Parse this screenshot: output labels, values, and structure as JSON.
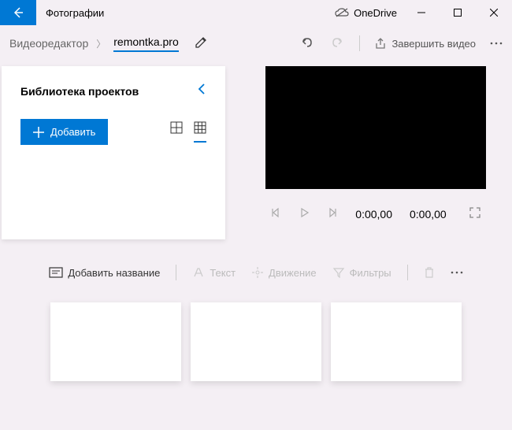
{
  "titlebar": {
    "app_title": "Фотографии",
    "onedrive_label": "OneDrive"
  },
  "breadcrumb": {
    "parent": "Видеоредактор",
    "current": "remontka.pro"
  },
  "topbar": {
    "finish_label": "Завершить видео"
  },
  "library": {
    "title": "Библиотека проектов",
    "add_label": "Добавить"
  },
  "playback": {
    "current_time": "0:00,00",
    "total_time": "0:00,00"
  },
  "toolbar": {
    "add_title": "Добавить название",
    "text": "Текст",
    "motion": "Движение",
    "filters": "Фильтры"
  }
}
